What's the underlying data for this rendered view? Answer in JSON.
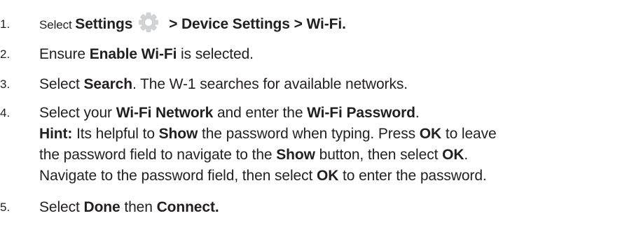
{
  "steps": [
    {
      "number": "1.",
      "prefix": "Select ",
      "bold1": "Settings",
      "icon": "gear-icon",
      "bold2": " > Device Settings > Wi-Fi."
    },
    {
      "number": "2.",
      "prefix": "Ensure ",
      "bold1": "Enable Wi-Fi",
      "suffix": " is selected."
    },
    {
      "number": "3.",
      "prefix": "Select ",
      "bold1": "Search",
      "suffix": ". The W-1 searches for available networks."
    },
    {
      "number": "4.",
      "line1": {
        "t1": "Select your ",
        "b1": "Wi-Fi Network",
        "t2": " and enter the ",
        "b2": "Wi-Fi Password",
        "t3": "."
      },
      "hint_label": "Hint:",
      "line2": {
        "t1": " Its helpful to ",
        "b1": "Show",
        "t2": " the password when typing. Press ",
        "b2": "OK",
        "t3": " to leave"
      },
      "line3": {
        "t1": "the password field to navigate to the ",
        "b1": "Show",
        "t2": " button, then select ",
        "b2": "OK",
        "t3": "."
      },
      "line4": {
        "t1": "Navigate to the password field, then select ",
        "b1": "OK",
        "t2": " to enter the password."
      }
    },
    {
      "number": "5.",
      "prefix": "Select ",
      "bold1": "Done",
      "mid": " then ",
      "bold2": "Connect."
    }
  ]
}
